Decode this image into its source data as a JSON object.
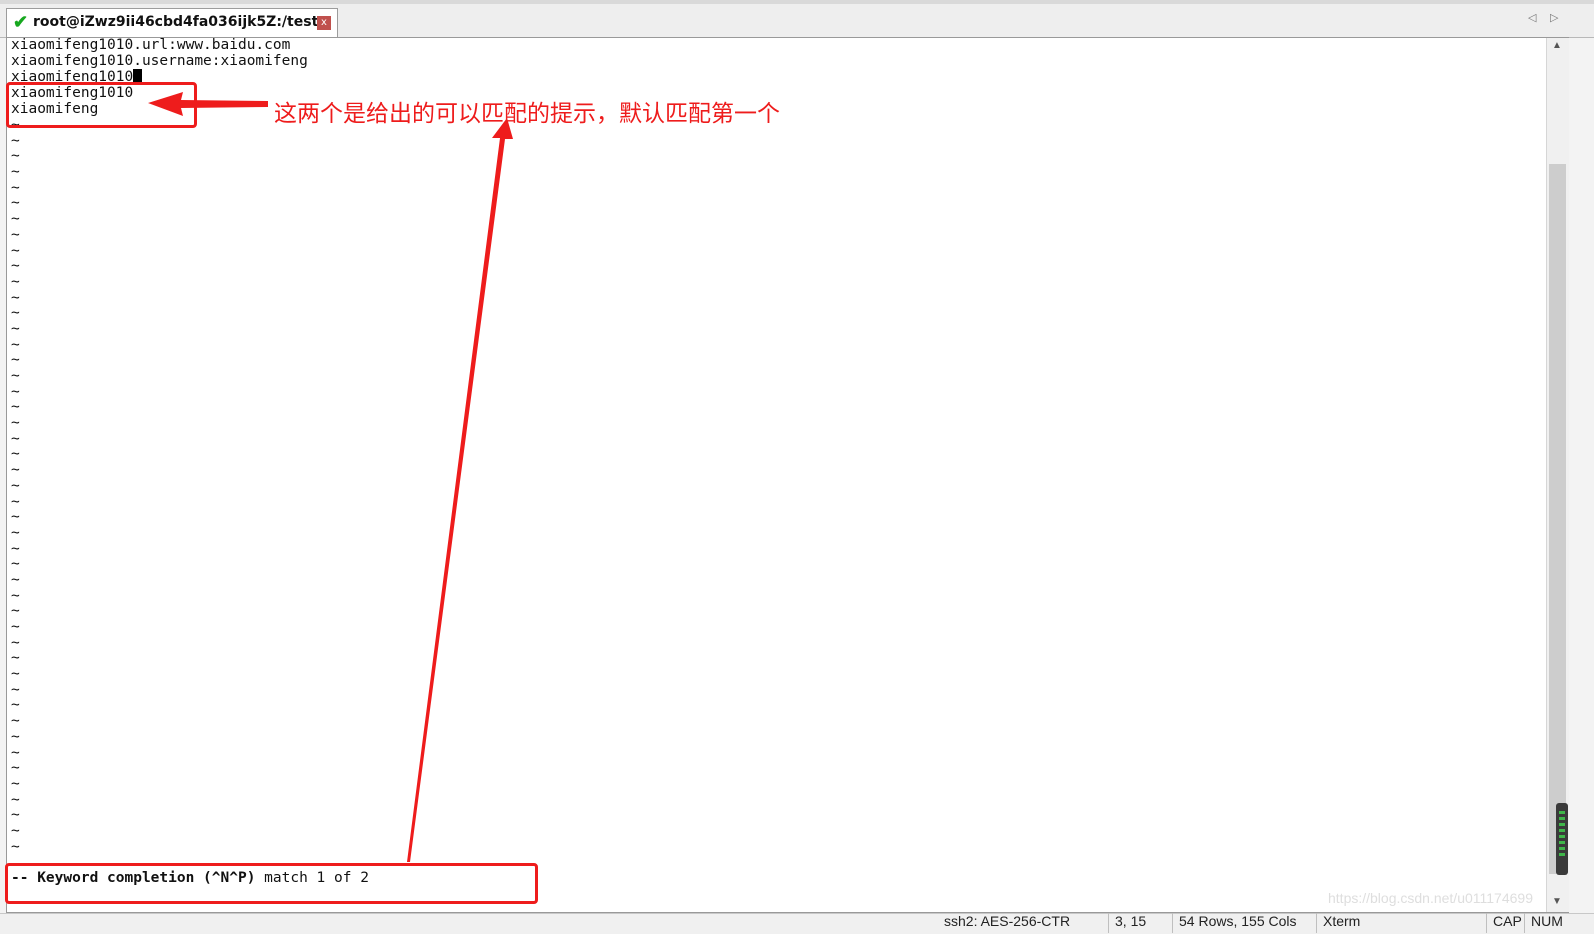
{
  "tab": {
    "title": "root@iZwz9ii46cbd4fa036ijk5Z:/test",
    "status_icon": "check-icon",
    "close_glyph": "x",
    "status_color": "#17a81f"
  },
  "terminal": {
    "lines": [
      "xiaomifeng1010.url:www.baidu.com",
      "xiaomifeng1010.username:xiaomifeng"
    ],
    "current_line": "xiaomifeng1010",
    "completion_menu": [
      "xiaomifeng1010",
      "xiaomifeng"
    ],
    "tilde": "~",
    "status_prefix": "-- Keyword completion (^N^P)",
    "status_suffix": " match 1 of 2"
  },
  "annotation": {
    "text": "这两个是给出的可以匹配的提示，默认匹配第一个",
    "color": "#ee1c1c"
  },
  "statusbar": {
    "cipher": "ssh2: AES-256-CTR",
    "cursor_pos": "3, 15",
    "size": "54 Rows, 155 Cols",
    "term": "Xterm",
    "caps": "CAP",
    "num": "NUM"
  },
  "watermark": "https://blog.csdn.net/u011174699"
}
